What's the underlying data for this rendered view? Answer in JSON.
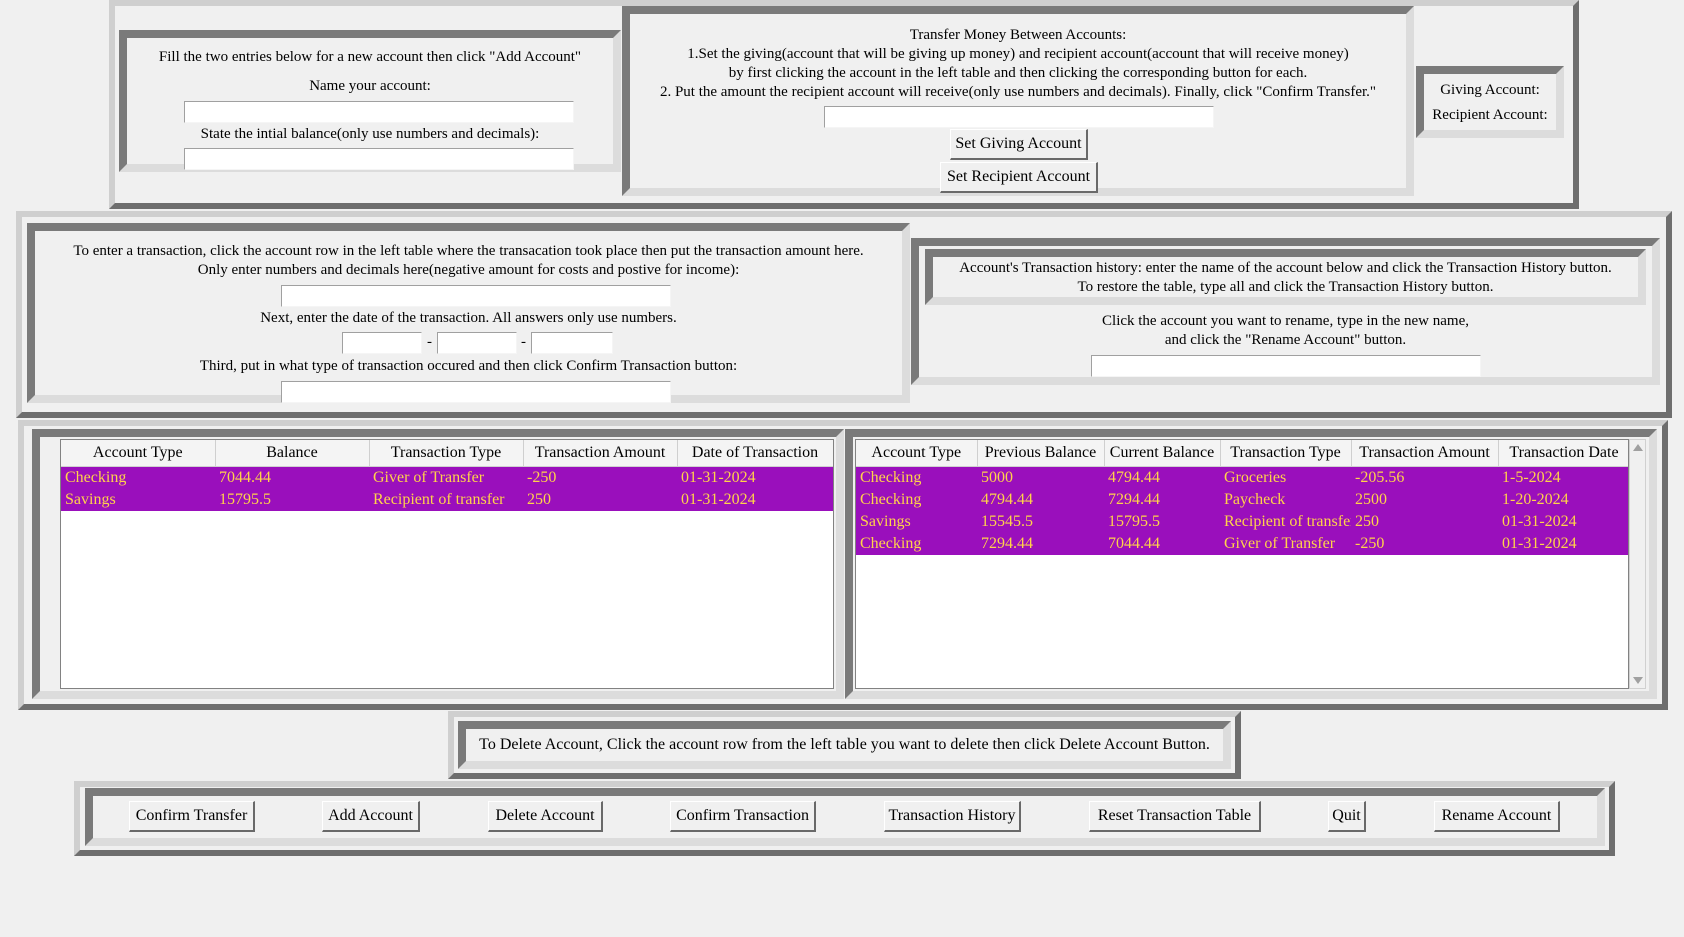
{
  "new_account": {
    "instructions": "Fill the two entries below for a new account then click \"Add Account\"",
    "name_label": "Name your account:",
    "name_value": "",
    "balance_label": "State the intial balance(only use numbers and decimals):",
    "balance_value": ""
  },
  "transfer": {
    "title": "Transfer Money Between Accounts:",
    "line1": "1.Set the giving(account that will be giving up money) and recipient account(account that will receive money)",
    "line2": "by first clicking the account in the left table and then clicking the corresponding button for each.",
    "line3": "2. Put the amount the recipient account will receive(only use numbers and decimals). Finally, click \"Confirm Transfer.\"",
    "amount_value": "",
    "set_giving_label": "Set Giving Account",
    "set_recipient_label": "Set Recipient Account"
  },
  "transfer_status": {
    "giving_label": "Giving Account:",
    "recipient_label": "Recipient Account:"
  },
  "transaction_entry": {
    "line1": "To enter a transaction, click the account row in the left table where the transacation took place then put the transaction amount here.",
    "line2": "Only enter numbers and decimals here(negative amount for costs and postive for income):",
    "amount_value": "",
    "date_label": "Next, enter the date of the transaction. All answers only use numbers.",
    "date_sep": "-",
    "month_value": "",
    "day_value": "",
    "year_value": "",
    "type_label": "Third, put in what type of transaction occured and then click Confirm Transaction button:",
    "type_value": ""
  },
  "history_panel": {
    "line1": "Account's Transaction history: enter the name of the account below and click the Transaction History button.",
    "line2": "To restore the table, type all and click the Transaction History button.",
    "rename_line1": "Click the account you want to rename, type in the new name,",
    "rename_line2": "and click the \"Rename Account\" button.",
    "rename_value": ""
  },
  "accounts_table": {
    "headers": [
      "Account Type",
      "Balance",
      "Transaction Type",
      "Transaction Amount",
      "Date of Transaction"
    ],
    "rows": [
      [
        "Checking",
        "7044.44",
        "Giver of Transfer",
        "-250",
        "01-31-2024"
      ],
      [
        "Savings",
        "15795.5",
        "Recipient of transfer",
        "250",
        "01-31-2024"
      ]
    ]
  },
  "history_table": {
    "headers": [
      "Account Type",
      "Previous Balance",
      "Current Balance",
      "Transaction Type",
      "Transaction Amount",
      "Transaction Date"
    ],
    "rows": [
      [
        "Checking",
        "5000",
        "4794.44",
        "Groceries",
        "-205.56",
        "1-5-2024"
      ],
      [
        "Checking",
        "4794.44",
        "7294.44",
        "Paycheck",
        "2500",
        "1-20-2024"
      ],
      [
        "Savings",
        "15545.5",
        "15795.5",
        "Recipient of transfer",
        "250",
        "01-31-2024"
      ],
      [
        "Checking",
        "7294.44",
        "7044.44",
        "Giver of Transfer",
        "-250",
        "01-31-2024"
      ]
    ]
  },
  "delete_note": "To Delete Account, Click the account row from the left table you want to delete then click Delete Account Button.",
  "buttons": {
    "confirm_transfer": "Confirm Transfer",
    "add_account": "Add Account",
    "delete_account": "Delete Account",
    "confirm_transaction": "Confirm Transaction",
    "transaction_history": "Transaction History",
    "reset_table": "Reset Transaction Table",
    "quit": "Quit",
    "rename_account": "Rename Account"
  },
  "colors": {
    "row_background": "#9a0fbc",
    "row_text": "#ffd34a"
  }
}
